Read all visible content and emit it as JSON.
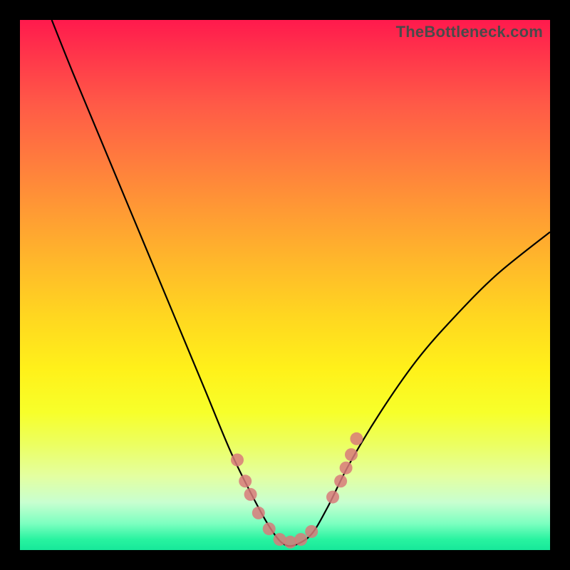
{
  "watermark": "TheBottleneck.com",
  "chart_data": {
    "type": "line",
    "title": "",
    "xlabel": "",
    "ylabel": "",
    "xlim": [
      0,
      100
    ],
    "ylim": [
      0,
      100
    ],
    "grid": false,
    "series": [
      {
        "name": "bottleneck-curve",
        "x": [
          6,
          10,
          15,
          20,
          25,
          30,
          35,
          40,
          45,
          48,
          50,
          52,
          55,
          58,
          62,
          68,
          75,
          82,
          90,
          100
        ],
        "y": [
          100,
          90,
          78,
          66,
          54,
          42,
          30,
          18,
          8,
          3,
          1,
          1,
          3,
          8,
          16,
          26,
          36,
          44,
          52,
          60
        ]
      }
    ],
    "markers": {
      "name": "highlight-dots",
      "x": [
        41,
        42.5,
        43.5,
        45,
        47,
        49,
        51,
        53,
        55,
        59,
        60.5,
        61.5,
        62.5,
        63.5
      ],
      "y": [
        17,
        13,
        10.5,
        7,
        4,
        2,
        1.5,
        2,
        3.5,
        10,
        13,
        15.5,
        18,
        21
      ]
    },
    "colors": {
      "curve": "#000000",
      "markers": "#d87a7a",
      "gradient_top": "#ff1a4d",
      "gradient_bottom": "#17e89a"
    }
  }
}
